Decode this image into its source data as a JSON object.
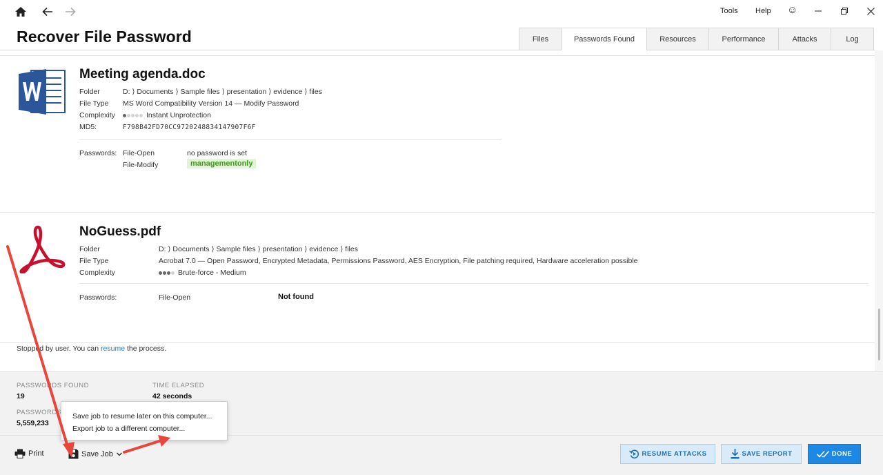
{
  "window": {
    "menu_tools": "Tools",
    "menu_help": "Help",
    "smiley": "☺"
  },
  "app": {
    "title": "Recover File Password"
  },
  "tabs": [
    {
      "label": "Files"
    },
    {
      "label": "Passwords Found",
      "active": true
    },
    {
      "label": "Resources"
    },
    {
      "label": "Performance"
    },
    {
      "label": "Attacks"
    },
    {
      "label": "Log"
    }
  ],
  "files": [
    {
      "name": "Meeting agenda.doc",
      "icon": "word-doc-icon",
      "folder_label": "Folder",
      "folder": "D: ⟩ Documents ⟩ Sample files ⟩ presentation ⟩ evidence ⟩ files",
      "type_label": "File Type",
      "type": "MS Word Compatibility Version 14 — Modify Password",
      "complexity_label": "Complexity",
      "complexity": "Instant Unprotection",
      "complexity_level": 1,
      "md5_label": "MD5:",
      "md5": "F798B42FD70CC9720248834147907F6F",
      "passwords_label": "Passwords:",
      "passwords": [
        {
          "type": "File-Open",
          "value": "no password is set",
          "found": false
        },
        {
          "type": "File-Modify",
          "value": "managementonly",
          "found": true
        }
      ]
    },
    {
      "name": "NoGuess.pdf",
      "icon": "acrobat-pdf-icon",
      "folder_label": "Folder",
      "folder": "D: ⟩ Documents ⟩ Sample files ⟩ presentation ⟩ evidence ⟩ files",
      "type_label": "File Type",
      "type": "Acrobat 7.0 — Open Password, Encrypted Metadata, Permissions Password, AES Encryption, File patching required, Hardware acceleration possible",
      "complexity_label": "Complexity",
      "complexity": "Brute-force - Medium",
      "complexity_level": 3,
      "passwords_label": "Passwords:",
      "passwords": [
        {
          "type": "File-Open",
          "value": "Not found",
          "found": false
        }
      ]
    }
  ],
  "status": {
    "prefix": "Stopped by user. You can ",
    "link": "resume",
    "suffix": " the process."
  },
  "stats": {
    "passwords_found_caption": "PASSWORDS FOUND",
    "passwords_found": "19",
    "time_elapsed_caption": "TIME ELAPSED",
    "time_elapsed": "42 seconds",
    "passwords_caption": "PASSWORDS",
    "passwords": "5,559,233"
  },
  "bottom": {
    "print_label": "Print",
    "save_job_label": "Save Job",
    "resume_attacks_label": "RESUME ATTACKS",
    "save_report_label": "SAVE REPORT",
    "done_label": "DONE"
  },
  "save_job_menu": {
    "items": [
      {
        "label": "Save job to resume later on this computer..."
      },
      {
        "label": "Export job to a different computer..."
      }
    ]
  },
  "colors": {
    "accent": "#1e88e5",
    "link": "#1f7bc1",
    "found_bg": "#e2f3d6",
    "found_text": "#3a9a1c",
    "annotation_arrow": "#e8463a",
    "word_blue": "#2b579a",
    "acrobat_red": "#c8102e"
  }
}
